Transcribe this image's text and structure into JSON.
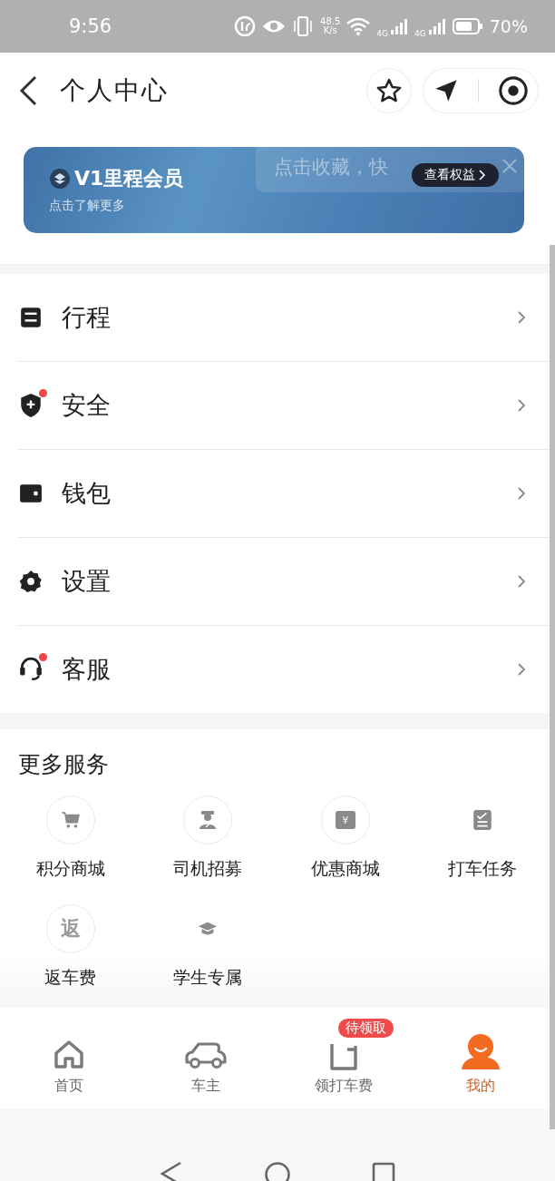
{
  "status_bar": {
    "time": "9:56",
    "speed_value": "48.5",
    "speed_unit": "K/s",
    "net_1": "4G",
    "net_2": "4G",
    "battery": "70%"
  },
  "header": {
    "title": "个人中心"
  },
  "tooltip": {
    "text": "点击收藏，快"
  },
  "banner": {
    "title": "V1里程会员",
    "subtitle": "点击了解更多",
    "button": "查看权益"
  },
  "menu": [
    {
      "kind": "trip",
      "label": "行程",
      "badge": false
    },
    {
      "kind": "safety",
      "label": "安全",
      "badge": true
    },
    {
      "kind": "wallet",
      "label": "钱包",
      "badge": false
    },
    {
      "kind": "settings",
      "label": "设置",
      "badge": false
    },
    {
      "kind": "support",
      "label": "客服",
      "badge": true
    }
  ],
  "services": {
    "title": "更多服务",
    "items": [
      {
        "kind": "cart",
        "label": "积分商城"
      },
      {
        "kind": "driver",
        "label": "司机招募"
      },
      {
        "kind": "coupon",
        "label": "优惠商城",
        "icon_text": "¥"
      },
      {
        "kind": "task",
        "label": "打车任务"
      },
      {
        "kind": "glyph",
        "label": "返车费",
        "icon_text": "返"
      },
      {
        "kind": "student",
        "label": "学生专属"
      }
    ]
  },
  "tabs": [
    {
      "kind": "home",
      "label": "首页",
      "selected": false
    },
    {
      "kind": "car",
      "label": "车主",
      "selected": false
    },
    {
      "kind": "box",
      "label": "领打车费",
      "selected": false,
      "badge": "待领取"
    },
    {
      "kind": "me",
      "label": "我的",
      "selected": true
    }
  ]
}
